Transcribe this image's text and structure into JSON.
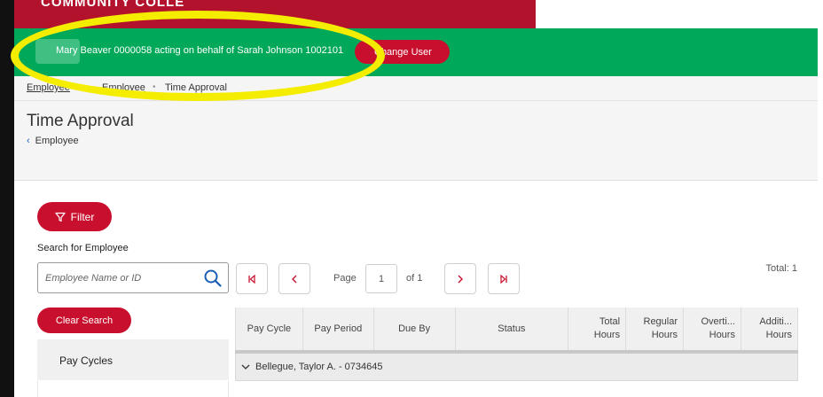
{
  "banner": {
    "college_name": "COMMUNITY COLLE"
  },
  "proxy": {
    "text": "Mary Beaver 0000058 acting on behalf of Sarah Johnson 1002101",
    "change_user_label": "Change User"
  },
  "breadcrumb": {
    "items": [
      "Employee",
      "Employee",
      "Time Approval"
    ]
  },
  "page": {
    "title": "Time Approval",
    "back_label": "Employee"
  },
  "filter": {
    "label": "Filter"
  },
  "search": {
    "label": "Search for Employee",
    "placeholder": "Employee Name or ID",
    "clear_label": "Clear Search"
  },
  "pager": {
    "page_label": "Page",
    "current_page": "1",
    "of_label": "of 1",
    "total_label": "Total: 1"
  },
  "sidebar": {
    "pay_cycles_label": "Pay Cycles"
  },
  "table": {
    "columns": [
      "Pay Cycle",
      "Pay Period",
      "Due By",
      "Status",
      "Total Hours",
      "Regular Hours",
      "Overti... Hours",
      "Additi... Hours"
    ],
    "group_row": "Bellegue, Taylor A. - 0734645"
  },
  "colors": {
    "green": "#00a859",
    "red": "#c8102e",
    "highlight": "#f5ed00"
  }
}
